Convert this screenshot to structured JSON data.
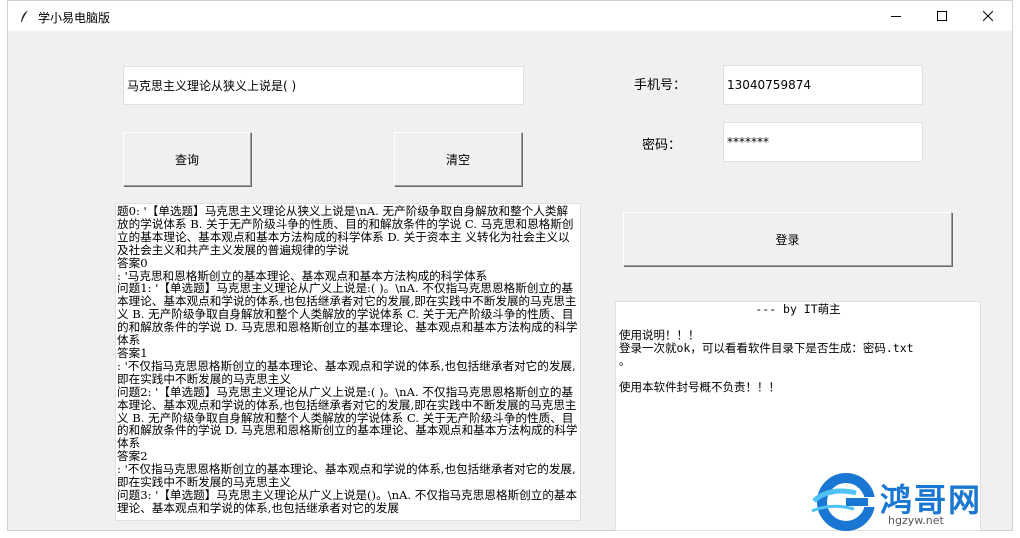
{
  "window": {
    "title": "学小易电脑版",
    "minimize_icon": "minimize-icon",
    "maximize_icon": "maximize-icon",
    "close_icon": "close-icon"
  },
  "query": {
    "value": "马克思主义理论从狭义上说是( )",
    "search_label": "查询",
    "clear_label": "清空"
  },
  "login": {
    "phone_label": "手机号：",
    "phone_value": "13040759874",
    "password_label": "密码：",
    "password_value": "*******",
    "login_label": "登录"
  },
  "results": {
    "lines": [
      "题0: '【单选题】马克思主义理论从狭义上说是\\nA. 无产阶级争取自身解放和整个人类解放的学说体系 B. 关于无产阶级斗争的性质、目的和解放条件的学说 C. 马克思和恩格斯创立的基本理论、基本观点和基本方法构成的科学体系 D. 关于资本主 义转化为社会主义以及社会主义和共产主义发展的普遍规律的学说",
      "答案0",
      ": '马克思和恩格斯创立的基本理论、基本观点和基本方法构成的科学体系",
      "问题1: '【单选题】马克思主义理论从广义上说是:( )。\\nA. 不仅指马克思恩格斯创立的基本理论、基本观点和学说的体系,也包括继承者对它的发展,即在实践中不断发展的马克思主义 B. 无产阶级争取自身解放和整个人类解放的学说体系 C. 关于无产阶级斗争的性质、目的和解放条件的学说 D. 马克思和恩格斯创立的基本理论、基本观点和基本方法构成的科学体系",
      "答案1",
      ": '不仅指马克思恩格斯创立的基本理论、基本观点和学说的体系,也包括继承者对它的发展,即在实践中不断发展的马克思主义",
      "问题2: '【单选题】马克思主义理论从广义上说是:( )。\\nA. 不仅指马克思恩格斯创立的基本理论、基本观点和学说的体系,也包括继承者对它的发展,即在实践中不断发展的马克思主义 B. 无产阶级争取自身解放和整个人类解放的学说体系 C. 关于无产阶级斗争的性质、目的和解放条件的学说 D. 马克思和恩格斯创立的基本理论、基本观点和基本方法构成的科学体系",
      "答案2",
      ": '不仅指马克思恩格斯创立的基本理论、基本观点和学说的体系,也包括继承者对它的发展,即在实践中不断发展的马克思主义",
      "问题3: '【单选题】马克思主义理论从广义上说是()。\\nA. 不仅指马克思恩格斯创立的基本理论、基本观点和学说的体系,也包括继承者对它的发展"
    ]
  },
  "info": {
    "lines": [
      "--- by IT萌主",
      "",
      "使用说明！！！",
      "登录一次就ok，可以看看软件目录下是否生成：密码.txt",
      "。",
      "",
      "使用本软件封号概不负责！！！"
    ]
  },
  "watermark": {
    "name": "鸿哥网",
    "url": "hgzyw.net",
    "logo_icon": "g-logo-icon",
    "colors": {
      "blue": "#1976d2",
      "light_blue": "#4fc3f7"
    }
  }
}
